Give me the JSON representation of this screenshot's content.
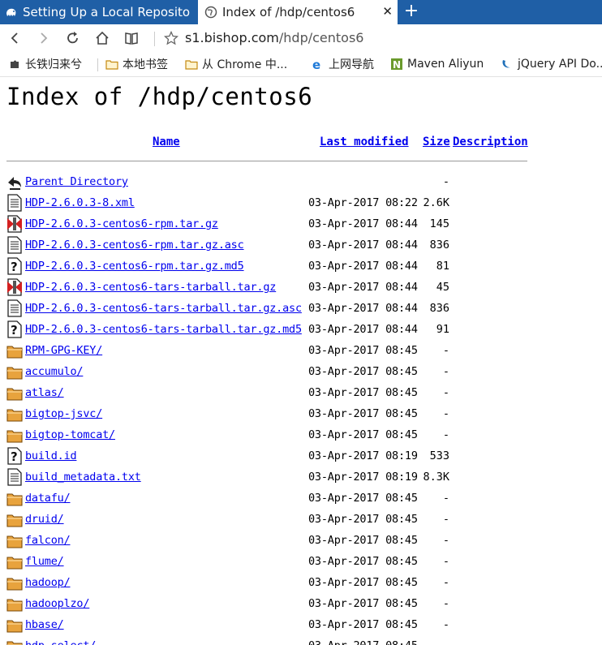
{
  "browser": {
    "tabs": [
      {
        "title": "Setting Up a Local Reposito",
        "active": false
      },
      {
        "title": "Index of /hdp/centos6",
        "active": true
      }
    ],
    "tab_close": "✕",
    "new_tab": "+",
    "url_host": "s1.bishop.com",
    "url_path": "/hdp/centos6",
    "bookmarks": [
      {
        "label": "长铁归来兮",
        "icon": "extension-icon"
      },
      {
        "label": "本地书签",
        "icon": "folder-icon"
      },
      {
        "label": "从 Chrome 中...",
        "icon": "folder-icon"
      },
      {
        "label": "上网导航",
        "icon": "ie-icon"
      },
      {
        "label": "Maven Aliyun",
        "icon": "maven-icon"
      },
      {
        "label": "jQuery API Do...",
        "icon": "jquery-icon"
      }
    ]
  },
  "page": {
    "title": "Index of /hdp/centos6",
    "columns": {
      "name": "Name",
      "modified": "Last modified",
      "size": "Size",
      "description": "Description"
    },
    "rows": [
      {
        "name": "Parent Directory",
        "modified": "",
        "size": "-",
        "icon": "back"
      },
      {
        "name": "HDP-2.6.0.3-8.xml",
        "modified": "03-Apr-2017 08:22",
        "size": "2.6K",
        "icon": "text"
      },
      {
        "name": "HDP-2.6.0.3-centos6-rpm.tar.gz",
        "modified": "03-Apr-2017 08:44",
        "size": "145",
        "icon": "archive"
      },
      {
        "name": "HDP-2.6.0.3-centos6-rpm.tar.gz.asc",
        "modified": "03-Apr-2017 08:44",
        "size": "836",
        "icon": "text"
      },
      {
        "name": "HDP-2.6.0.3-centos6-rpm.tar.gz.md5",
        "modified": "03-Apr-2017 08:44",
        "size": "81",
        "icon": "unknown"
      },
      {
        "name": "HDP-2.6.0.3-centos6-tars-tarball.tar.gz",
        "modified": "03-Apr-2017 08:44",
        "size": "45",
        "icon": "archive"
      },
      {
        "name": "HDP-2.6.0.3-centos6-tars-tarball.tar.gz.asc",
        "modified": "03-Apr-2017 08:44",
        "size": "836",
        "icon": "text"
      },
      {
        "name": "HDP-2.6.0.3-centos6-tars-tarball.tar.gz.md5",
        "modified": "03-Apr-2017 08:44",
        "size": "91",
        "icon": "unknown"
      },
      {
        "name": "RPM-GPG-KEY/",
        "modified": "03-Apr-2017 08:45",
        "size": "-",
        "icon": "folder"
      },
      {
        "name": "accumulo/",
        "modified": "03-Apr-2017 08:45",
        "size": "-",
        "icon": "folder"
      },
      {
        "name": "atlas/",
        "modified": "03-Apr-2017 08:45",
        "size": "-",
        "icon": "folder"
      },
      {
        "name": "bigtop-jsvc/",
        "modified": "03-Apr-2017 08:45",
        "size": "-",
        "icon": "folder"
      },
      {
        "name": "bigtop-tomcat/",
        "modified": "03-Apr-2017 08:45",
        "size": "-",
        "icon": "folder"
      },
      {
        "name": "build.id",
        "modified": "03-Apr-2017 08:19",
        "size": "533",
        "icon": "unknown"
      },
      {
        "name": "build_metadata.txt",
        "modified": "03-Apr-2017 08:19",
        "size": "8.3K",
        "icon": "text"
      },
      {
        "name": "datafu/",
        "modified": "03-Apr-2017 08:45",
        "size": "-",
        "icon": "folder"
      },
      {
        "name": "druid/",
        "modified": "03-Apr-2017 08:45",
        "size": "-",
        "icon": "folder"
      },
      {
        "name": "falcon/",
        "modified": "03-Apr-2017 08:45",
        "size": "-",
        "icon": "folder"
      },
      {
        "name": "flume/",
        "modified": "03-Apr-2017 08:45",
        "size": "-",
        "icon": "folder"
      },
      {
        "name": "hadoop/",
        "modified": "03-Apr-2017 08:45",
        "size": "-",
        "icon": "folder"
      },
      {
        "name": "hadooplzo/",
        "modified": "03-Apr-2017 08:45",
        "size": "-",
        "icon": "folder"
      },
      {
        "name": "hbase/",
        "modified": "03-Apr-2017 08:45",
        "size": "-",
        "icon": "folder"
      },
      {
        "name": "hdp-select/",
        "modified": "03-Apr-2017 08:45",
        "size": "-",
        "icon": "folder"
      }
    ]
  },
  "colors": {
    "tabstrip": "#1f5fa6",
    "link": "#0000ee",
    "folder": "#e8a33d"
  }
}
